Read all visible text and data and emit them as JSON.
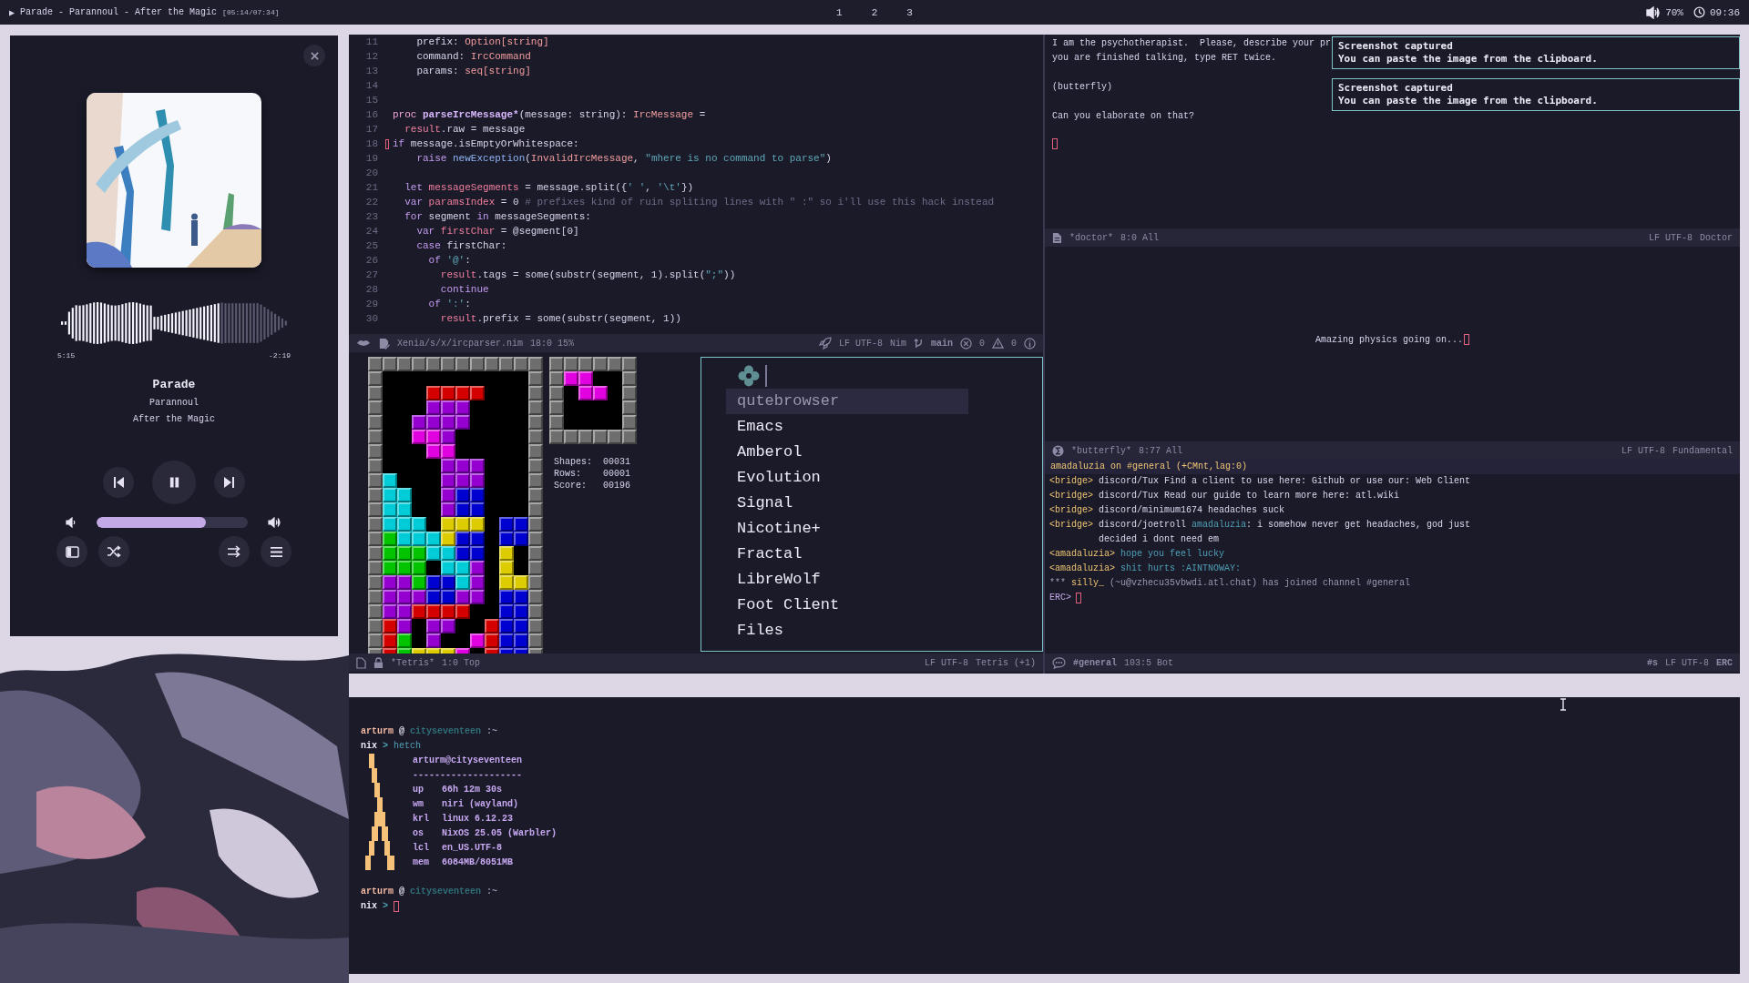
{
  "top_bar": {
    "play_glyph": "▶",
    "now_playing": "Parade - Parannoul - After the Magic",
    "track_time": "[05:14/07:34]",
    "workspaces": [
      "1",
      "2",
      "3"
    ],
    "volume": "70%",
    "clock": "09:36"
  },
  "player": {
    "progress": {
      "level": 0.7
    },
    "elapsed": "5:15",
    "remaining": "-2:19",
    "title": "Parade",
    "artist": "Parannoul",
    "album": "After the Magic",
    "volume": {
      "level": 0.72
    }
  },
  "code_editor": {
    "lines": [
      {
        "number": "11",
        "cursor": false,
        "segments": [
          {
            "kind": "plain",
            "text": "    prefix: "
          },
          {
            "kind": "type",
            "text": "Option[string]"
          }
        ]
      },
      {
        "number": "12",
        "cursor": false,
        "segments": [
          {
            "kind": "plain",
            "text": "    command: "
          },
          {
            "kind": "type",
            "text": "IrcCommand"
          }
        ]
      },
      {
        "number": "13",
        "cursor": false,
        "segments": [
          {
            "kind": "plain",
            "text": "    params: "
          },
          {
            "kind": "type",
            "text": "seq[string]"
          }
        ]
      },
      {
        "number": "14",
        "cursor": false
      },
      {
        "number": "15",
        "cursor": false
      },
      {
        "number": "16",
        "cursor": false,
        "segments": [
          {
            "kind": "proc",
            "text": "proc "
          },
          {
            "kind": "fn",
            "text": "parseIrcMessage*"
          },
          {
            "kind": "plain",
            "text": "(message: string): "
          },
          {
            "kind": "type",
            "text": "IrcMessage"
          },
          {
            "kind": "plain",
            "text": " ="
          }
        ]
      },
      {
        "number": "17",
        "cursor": false,
        "segments": [
          {
            "kind": "var",
            "text": "  result"
          },
          {
            "kind": "plain",
            "text": ".raw = message"
          }
        ]
      },
      {
        "number": "18",
        "cursor": true,
        "segments": [
          {
            "kind": "kw",
            "text": "if"
          },
          {
            "kind": "plain",
            "text": " message.isEmptyOrWhitespace:"
          }
        ]
      },
      {
        "number": "19",
        "cursor": false,
        "segments": [
          {
            "kind": "kw",
            "text": "    raise"
          },
          {
            "kind": "call",
            "text": " newException"
          },
          {
            "kind": "plain",
            "text": "("
          },
          {
            "kind": "type",
            "text": "InvalidIrcMessage"
          },
          {
            "kind": "plain",
            "text": ", "
          },
          {
            "kind": "str",
            "text": "\"mhere is no command to parse\""
          },
          {
            "kind": "plain",
            "text": ")"
          }
        ]
      },
      {
        "number": "20",
        "cursor": false
      },
      {
        "number": "21",
        "cursor": false,
        "segments": [
          {
            "kind": "kw",
            "text": "  let"
          },
          {
            "kind": "var",
            "text": " messageSegments"
          },
          {
            "kind": "plain",
            "text": " = message.split({"
          },
          {
            "kind": "str",
            "text": "' '"
          },
          {
            "kind": "plain",
            "text": ", "
          },
          {
            "kind": "str",
            "text": "'\\t'"
          },
          {
            "kind": "plain",
            "text": "})"
          }
        ]
      },
      {
        "number": "22",
        "cursor": false,
        "segments": [
          {
            "kind": "kw",
            "text": "  var"
          },
          {
            "kind": "var",
            "text": " paramsIndex"
          },
          {
            "kind": "plain",
            "text": " = 0 "
          },
          {
            "kind": "comment",
            "text": "# prefixes kind of ruin spliting lines with \" :\" so i'll use this hack instead"
          }
        ]
      },
      {
        "number": "23",
        "cursor": false,
        "segments": [
          {
            "kind": "kw",
            "text": "  for"
          },
          {
            "kind": "plain",
            "text": " segment "
          },
          {
            "kind": "kw",
            "text": "in"
          },
          {
            "kind": "plain",
            "text": " messageSegments:"
          }
        ]
      },
      {
        "number": "24",
        "cursor": false,
        "segments": [
          {
            "kind": "kw",
            "text": "    var"
          },
          {
            "kind": "var",
            "text": " firstChar"
          },
          {
            "kind": "plain",
            "text": " = @segment[0]"
          }
        ]
      },
      {
        "number": "25",
        "cursor": false,
        "segments": [
          {
            "kind": "kw",
            "text": "    case"
          },
          {
            "kind": "plain",
            "text": " firstChar:"
          }
        ]
      },
      {
        "number": "26",
        "cursor": false,
        "segments": [
          {
            "kind": "kw",
            "text": "      of"
          },
          {
            "kind": "str",
            "text": " '@'"
          },
          {
            "kind": "plain",
            "text": ":"
          }
        ]
      },
      {
        "number": "27",
        "cursor": false,
        "segments": [
          {
            "kind": "var",
            "text": "        result"
          },
          {
            "kind": "plain",
            "text": ".tags = some(substr(segment, 1).split("
          },
          {
            "kind": "str",
            "text": "\";\""
          },
          {
            "kind": "plain",
            "text": "))"
          }
        ]
      },
      {
        "number": "28",
        "cursor": false,
        "segments": [
          {
            "kind": "kw",
            "text": "        continue"
          }
        ]
      },
      {
        "number": "29",
        "cursor": false,
        "segments": [
          {
            "kind": "kw",
            "text": "      of"
          },
          {
            "kind": "str",
            "text": " ':'"
          },
          {
            "kind": "plain",
            "text": ":"
          }
        ]
      },
      {
        "number": "30",
        "cursor": false,
        "segments": [
          {
            "kind": "var",
            "text": "        result"
          },
          {
            "kind": "plain",
            "text": ".prefix = some(substr(segment, 1))"
          }
        ]
      }
    ],
    "modeline": {
      "path": "Xenia/s/x/ircparser.nim",
      "position": "18:0 15%",
      "encoding": "LF UTF-8",
      "mode": "Nim",
      "branch": "main",
      "errors": "0",
      "warnings": "0"
    }
  },
  "tetris": {
    "stats": [
      {
        "label": "Shapes:",
        "value": "00031"
      },
      {
        "label": "Rows:",
        "value": "00001"
      },
      {
        "label": "Score:",
        "value": "00196"
      }
    ],
    "modeline": {
      "buffer": "*Tetris*",
      "position": "1:0 Top",
      "encoding": "LF UTF-8",
      "mode": "Tetris (+1)"
    }
  },
  "launcher": {
    "items": [
      {
        "label": "qutebrowser",
        "selected": true
      },
      {
        "label": "Emacs",
        "selected": false
      },
      {
        "label": "Amberol",
        "selected": false
      },
      {
        "label": "Evolution",
        "selected": false
      },
      {
        "label": "Signal",
        "selected": false
      },
      {
        "label": "Nicotine+",
        "selected": false
      },
      {
        "label": "Fractal",
        "selected": false
      },
      {
        "label": "LibreWolf",
        "selected": false
      },
      {
        "label": "Foot Client",
        "selected": false
      },
      {
        "label": "Files",
        "selected": false
      }
    ]
  },
  "doctor": {
    "paragraphs": [
      [
        "I am the psychotherapist.  Please, describe your pr",
        "you are finished talking, type RET twice."
      ],
      [
        "(butterfly)"
      ],
      [
        "Can you elaborate on that?"
      ]
    ],
    "modeline": {
      "buffer": "*doctor*",
      "position": "8:0 All",
      "encoding": "LF UTF-8",
      "mode": "Doctor"
    }
  },
  "notifications": [
    {
      "title": "Screenshot captured",
      "body": "You can paste the image from the clipboard."
    },
    {
      "title": "Screenshot captured",
      "body": "You can paste the image from the clipboard."
    }
  ],
  "butterfly": {
    "text": "Amazing physics going on...",
    "modeline": {
      "buffer": "*butterfly*",
      "position": "8:77 All",
      "encoding": "LF UTF-8",
      "mode": "Fundamental"
    }
  },
  "erc": {
    "header": "amadaluzia on #general (+CMnt,lag:0)",
    "messages": [
      {
        "kind": "line",
        "segments": [
          {
            "kind": "nick",
            "text": "<bridge>"
          },
          {
            "kind": "plain",
            "text": " discord/Tux Find a client to use here: Github or use our: Web Client"
          }
        ]
      },
      {
        "kind": "line",
        "segments": [
          {
            "kind": "nick",
            "text": "<bridge>"
          },
          {
            "kind": "plain",
            "text": " discord/Tux Read our guide to learn more here: atl.wiki"
          }
        ]
      },
      {
        "kind": "line",
        "segments": [
          {
            "kind": "nick",
            "text": "<bridge>"
          },
          {
            "kind": "plain",
            "text": " discord/minimum1674 headaches suck"
          }
        ]
      },
      {
        "kind": "line",
        "segments": [
          {
            "kind": "nick",
            "text": "<bridge>"
          },
          {
            "kind": "plain",
            "text": " discord/joetroll "
          },
          {
            "kind": "own",
            "text": "amadaluzia"
          },
          {
            "kind": "plain",
            "text": ": i somehow never get headaches, god just"
          }
        ]
      },
      {
        "kind": "wrap",
        "segments": [
          {
            "kind": "plain",
            "text": "decided i dont need em"
          }
        ]
      },
      {
        "kind": "line",
        "segments": [
          {
            "kind": "nick",
            "text": "<amadaluzia>"
          },
          {
            "kind": "own",
            "text": " hope you feel lucky"
          }
        ]
      },
      {
        "kind": "line",
        "segments": [
          {
            "kind": "nick",
            "text": "<amadaluzia>"
          },
          {
            "kind": "own",
            "text": " shit hurts :AINTNOWAY:"
          }
        ]
      },
      {
        "kind": "line",
        "segments": [
          {
            "kind": "dim",
            "text": "*** "
          },
          {
            "kind": "nick",
            "text": "silly_"
          },
          {
            "kind": "dim",
            "text": " (~u@vzhecu35vbwdi.atl.chat) has joined channel #general"
          }
        ]
      }
    ],
    "prompt": "ERC>",
    "modeline": {
      "buffer": "#general",
      "position": "103:5 Bot",
      "flags": "#s",
      "encoding": "LF UTF-8",
      "mode": "ERC"
    }
  },
  "terminal": {
    "prompts": [
      {
        "user": "arturm",
        "at": "@",
        "host": "cityseventeen",
        "path": ":~",
        "shell": "nix",
        "arrow": ">",
        "command": "hetch"
      },
      {
        "user": "arturm",
        "at": "@",
        "host": "cityseventeen",
        "path": ":~",
        "shell": "nix",
        "arrow": ">"
      }
    ],
    "fetch": {
      "header": "arturm@cityseventeen",
      "rule": "--------------------",
      "rows": [
        {
          "label": "up",
          "value": "66h 12m 30s"
        },
        {
          "label": "wm",
          "value": "niri (wayland)"
        },
        {
          "label": "krl",
          "value": "linux 6.12.23"
        },
        {
          "label": "os",
          "value": "NixOS 25.05 (Warbler)"
        },
        {
          "label": "lcl",
          "value": "en_US.UTF-8"
        },
        {
          "label": "mem",
          "value": "6084MB/8051MB"
        }
      ]
    }
  }
}
